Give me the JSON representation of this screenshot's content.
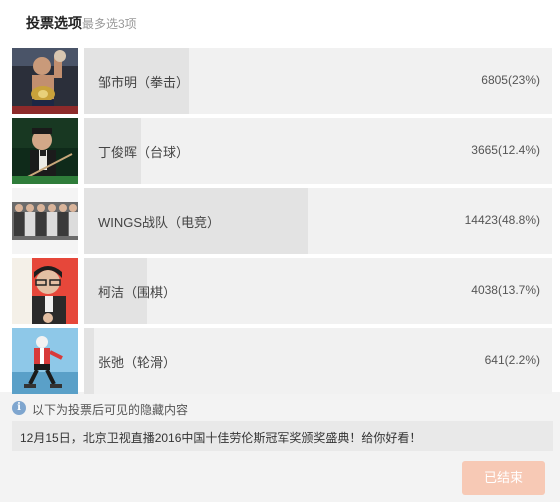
{
  "header": {
    "title": "投票选项",
    "subtitle": "最多选3项"
  },
  "options": [
    {
      "label": "邹市明（拳击）",
      "votes": "6805",
      "percent_text": "(23%)",
      "percent": 23,
      "photo": "boxer-champion-photo"
    },
    {
      "label": "丁俊晖（台球）",
      "votes": "3665",
      "percent_text": "(12.4%)",
      "percent": 12.4,
      "photo": "snooker-player-photo"
    },
    {
      "label": "WINGS战队（电竞）",
      "votes": "14423",
      "percent_text": "(48.8%)",
      "percent": 48.8,
      "photo": "esports-team-photo"
    },
    {
      "label": "柯洁（围棋）",
      "votes": "4038",
      "percent_text": "(13.7%)",
      "percent": 13.7,
      "photo": "go-player-photo"
    },
    {
      "label": "张弛（轮滑）",
      "votes": "641",
      "percent_text": "(2.2%)",
      "percent": 2.2,
      "photo": "roller-skater-photo"
    }
  ],
  "hidden_section": {
    "note": "以下为投票后可见的隐藏内容",
    "content": "12月15日，北京卫视直播2016中国十佳劳伦斯冠军奖颁奖盛典！给你好看！"
  },
  "button": {
    "label": "已结束"
  },
  "colors": {
    "bar_track": "#f1f1f1",
    "bar_fill": "#e3e3e3",
    "ended_button": "#f7c9b5",
    "info_icon": "#7fa6cf"
  }
}
